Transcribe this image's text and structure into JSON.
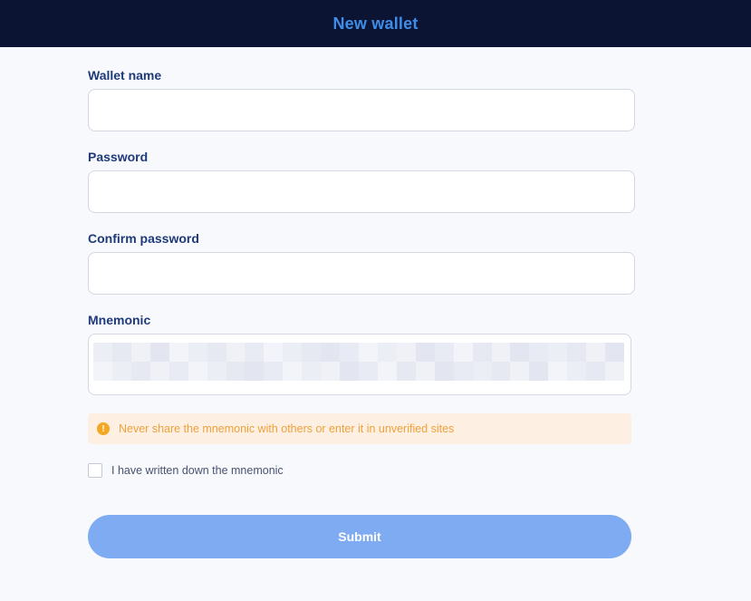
{
  "header": {
    "title": "New wallet"
  },
  "form": {
    "wallet_name": {
      "label": "Wallet name",
      "value": ""
    },
    "password": {
      "label": "Password",
      "value": ""
    },
    "confirm_password": {
      "label": "Confirm password",
      "value": ""
    },
    "mnemonic": {
      "label": "Mnemonic"
    }
  },
  "warning": {
    "text": "Never share the mnemonic with others or enter it in unverified sites",
    "icon": "info-icon"
  },
  "checkbox": {
    "label": "I have written down the mnemonic",
    "checked": false
  },
  "submit": {
    "label": "Submit"
  },
  "colors": {
    "header_bg": "#0b1433",
    "title": "#3d8eea",
    "label": "#1f3a7a",
    "warning_bg": "#fdf0e3",
    "warning_text": "#f0a03a",
    "submit_bg": "#7fabf3"
  }
}
